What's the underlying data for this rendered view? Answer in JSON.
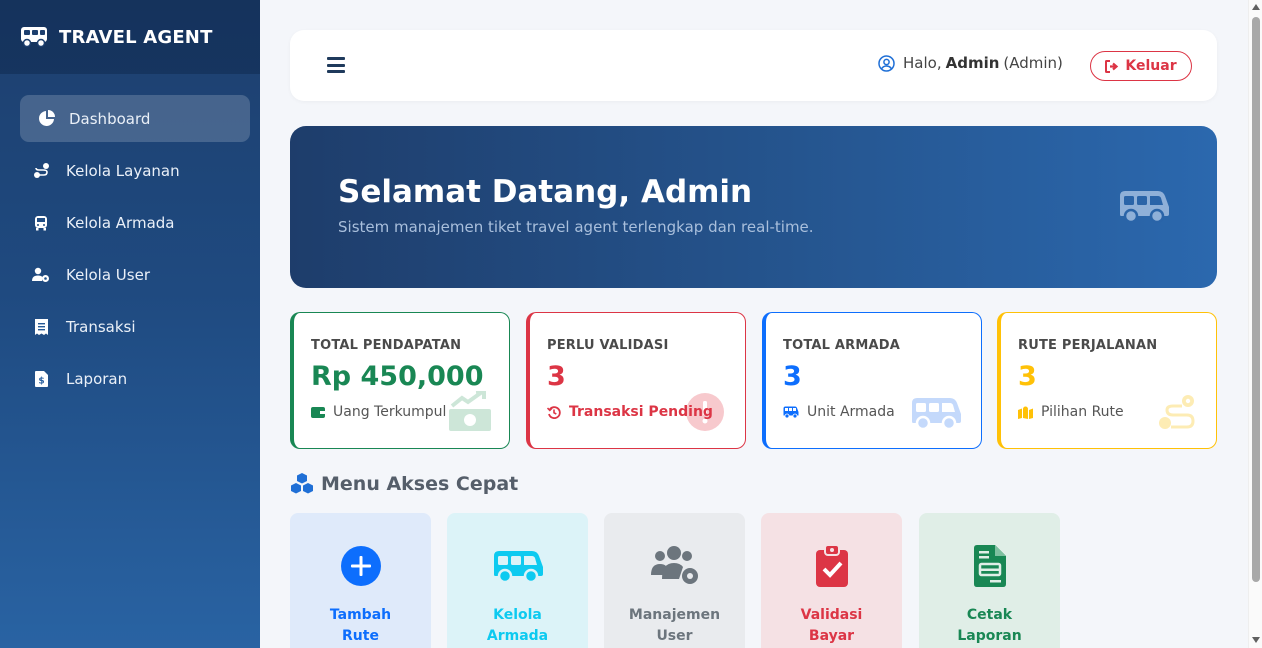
{
  "brand": {
    "title": "TRAVEL AGENT",
    "icon": "bus-icon"
  },
  "sidebar": {
    "items": [
      {
        "label": "Dashboard",
        "icon": "chart-pie-icon",
        "active": true
      },
      {
        "label": "Kelola Layanan",
        "icon": "route-icon"
      },
      {
        "label": "Kelola Armada",
        "icon": "bus-icon"
      },
      {
        "label": "Kelola User",
        "icon": "users-cog-icon"
      },
      {
        "label": "Transaksi",
        "icon": "receipt-icon"
      },
      {
        "label": "Laporan",
        "icon": "file-invoice-dollar-icon"
      }
    ]
  },
  "topbar": {
    "greeting_prefix": "Halo,",
    "user_name": "Admin",
    "user_role": "(Admin)",
    "logout_label": "Keluar"
  },
  "hero": {
    "title": "Selamat Datang, Admin",
    "subtitle": "Sistem manajemen tiket travel agent terlengkap dan real-time."
  },
  "stats": [
    {
      "label": "TOTAL PENDAPATAN",
      "value": "Rp 450,000",
      "footer": "Uang Terkumpul",
      "color": "#198754",
      "icon": "money-bill-trend-icon"
    },
    {
      "label": "PERLU VALIDASI",
      "value": "3",
      "footer": "Transaksi Pending",
      "color": "#dc3545",
      "icon": "history-icon"
    },
    {
      "label": "TOTAL ARMADA",
      "value": "3",
      "footer": "Unit Armada",
      "color": "#0d6efd",
      "icon": "bus-icon"
    },
    {
      "label": "RUTE PERJALANAN",
      "value": "3",
      "footer": "Pilihan Rute",
      "color": "#ffc107",
      "icon": "map-marked-icon"
    }
  ],
  "quick_menu": {
    "title": "Menu Akses Cepat",
    "items": [
      {
        "line1": "Tambah",
        "line2": "Rute",
        "color": "#0d6efd",
        "bg": "#dfeafa",
        "icon": "plus-circle-icon"
      },
      {
        "line1": "Kelola",
        "line2": "Armada",
        "color": "#0dcaf0",
        "bg": "#dcf3f8",
        "icon": "bus-icon"
      },
      {
        "line1": "Manajemen",
        "line2": "User",
        "color": "#6c757d",
        "bg": "#e9ebee",
        "icon": "users-cog-icon"
      },
      {
        "line1": "Validasi",
        "line2": "Bayar",
        "color": "#dc3545",
        "bg": "#f5e1e4",
        "icon": "clipboard-check-icon"
      },
      {
        "line1": "Cetak",
        "line2": "Laporan",
        "color": "#198754",
        "bg": "#e0eee7",
        "icon": "file-invoice-icon"
      }
    ]
  }
}
